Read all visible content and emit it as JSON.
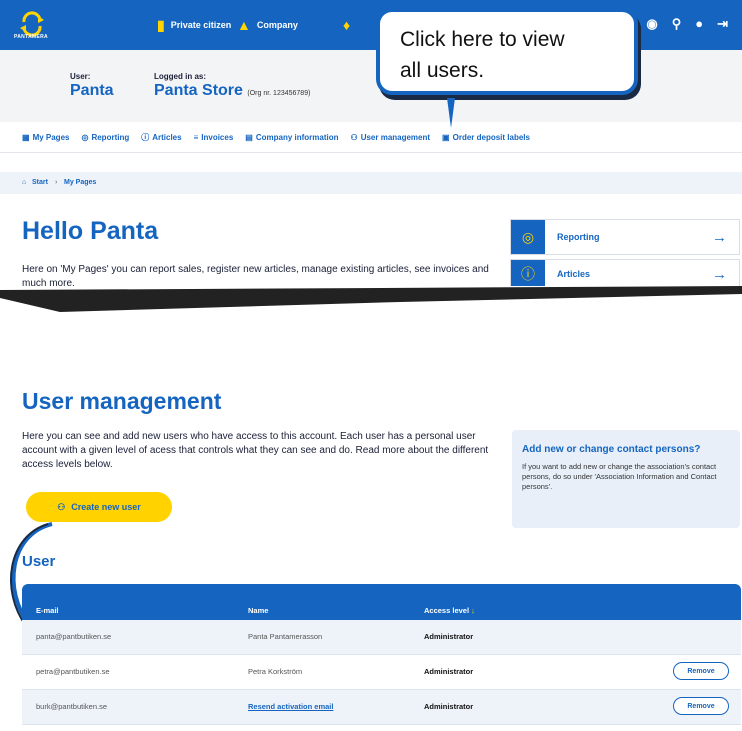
{
  "top_nav": {
    "logo_text": "PANTAMERA",
    "private_citizen": "Private citizen",
    "company": "Company"
  },
  "header": {
    "user_label": "User:",
    "user_name": "Panta",
    "logged_in_label": "Logged in as:",
    "logged_in_name": "Panta Store",
    "org": "(Org nr. 123456789)"
  },
  "tabs": [
    {
      "label": "My Pages",
      "icon": "grid-icon"
    },
    {
      "label": "Reporting",
      "icon": "reporting-icon"
    },
    {
      "label": "Articles",
      "icon": "info-icon"
    },
    {
      "label": "Invoices",
      "icon": "coins-icon"
    },
    {
      "label": "Company information",
      "icon": "building-icon"
    },
    {
      "label": "User management",
      "icon": "users-icon"
    },
    {
      "label": "Order deposit labels",
      "icon": "label-icon"
    }
  ],
  "breadcrumb": {
    "start": "Start",
    "sep": "›",
    "current": "My Pages"
  },
  "hello": {
    "title": "Hello Panta",
    "intro": "Here on 'My Pages' you can report sales, register new articles, manage existing articles, see invoices and much more."
  },
  "cards": [
    {
      "label": "Reporting",
      "arrow": "→"
    },
    {
      "label": "Articles",
      "arrow": "→"
    }
  ],
  "callout": {
    "line1": "Click here to view",
    "line2": "all users."
  },
  "user_management": {
    "title": "User management",
    "description": "Here you can see and add new users who have access to this account. Each user has a personal user account with a given level of acess that controls what they can see and do. Read more about the different access levels below.",
    "create_button": "Create new user",
    "side_title": "Add new or change contact persons?",
    "side_text": "If you want to add new or change the association's contact persons, do so under 'Association Information and Contact persons'."
  },
  "user_section": {
    "title": "User",
    "columns": [
      "E-mail",
      "Name",
      "Access level"
    ],
    "rows": [
      {
        "email": "panta@pantbutiken.se",
        "name": "Panta Pantamerasson",
        "access": "Administrator",
        "action": ""
      },
      {
        "email": "petra@pantbutiken.se",
        "name": "Petra Korkström",
        "access": "Administrator",
        "action": "Remove"
      },
      {
        "email": "burk@pantbutiken.se",
        "name": "Resend activation email",
        "access": "Administrator",
        "action": "Remove"
      }
    ]
  },
  "colors": {
    "primary": "#1565c0",
    "accent": "#ffd200"
  }
}
